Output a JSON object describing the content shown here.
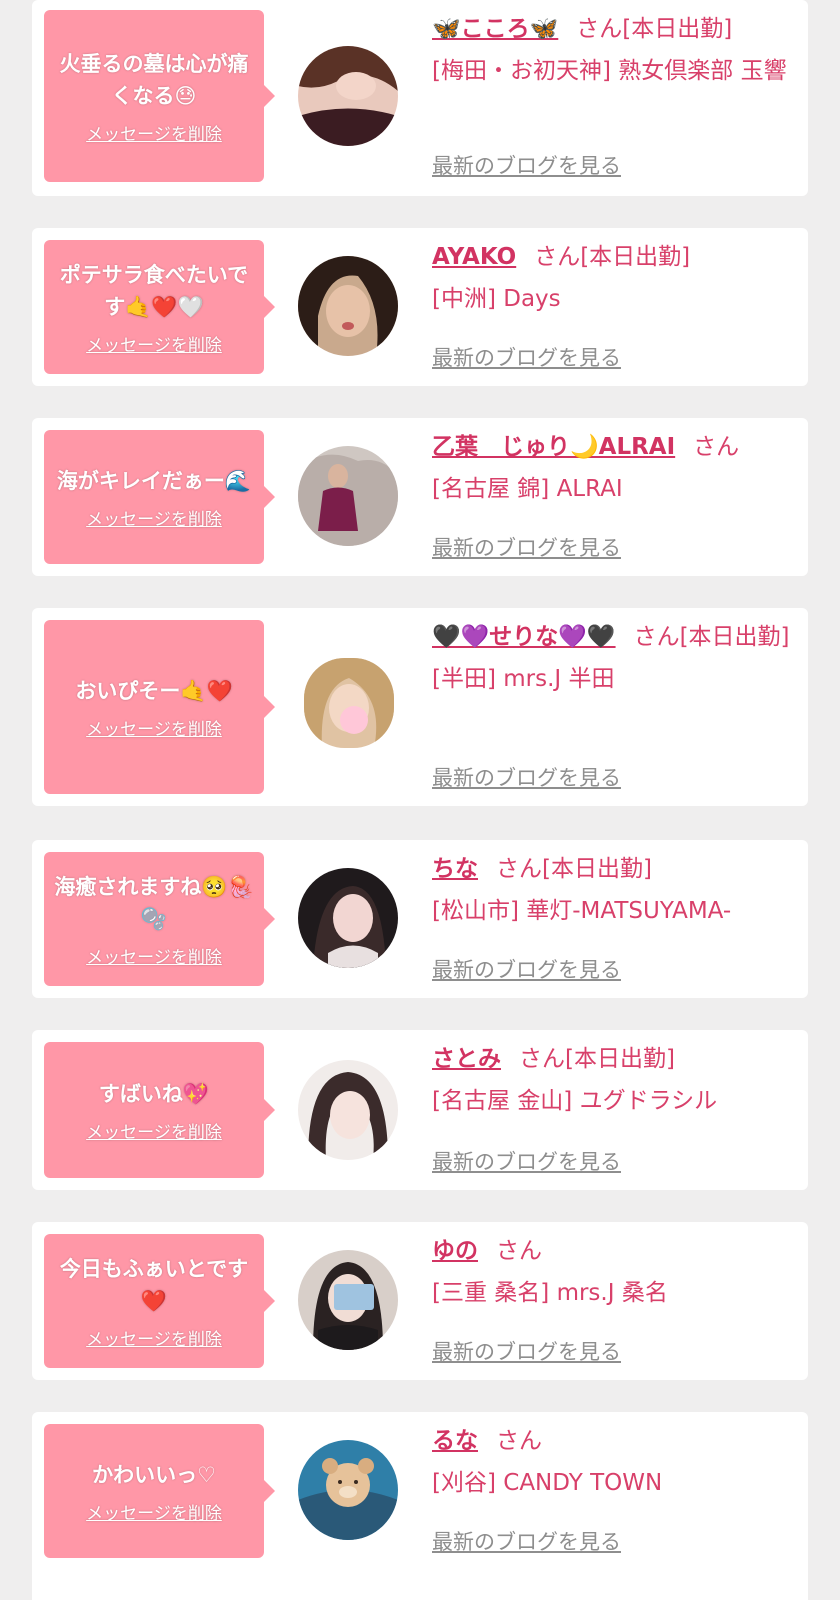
{
  "cards": [
    {
      "message": "火垂るの墓は心が痛くなる😓",
      "delete_label": "メッセージを削除",
      "name": "🦋こころ🦋",
      "san": "さん[本日出勤]",
      "shop": "[梅田・お初天神] 熟女倶楽部 玉響",
      "blog_label": "最新のブログを見る",
      "avatar": "avatar-woman-dark-top"
    },
    {
      "message": "ポテサラ食べたいです🤙❤️🤍",
      "delete_label": "メッセージを削除",
      "name": "AYAKO",
      "san": "さん[本日出勤]",
      "shop": "[中洲] Days",
      "blog_label": "最新のブログを見る",
      "avatar": "avatar-woman-selfie"
    },
    {
      "message": "海がキレイだぁー🌊",
      "delete_label": "メッセージを削除",
      "name": "乙葉　じゅり🌙ALRAI",
      "san": "さん",
      "shop": "[名古屋 錦] ALRAI",
      "blog_label": "最新のブログを見る",
      "avatar": "avatar-woman-on-chair"
    },
    {
      "message": "おいぴそー🤙❤️",
      "delete_label": "メッセージを削除",
      "name": "🖤💜せりな💜🖤",
      "san": "さん[本日出勤]",
      "shop": "[半田] mrs.J 半田",
      "blog_label": "最新のブログを見る",
      "avatar": "avatar-blonde-woman"
    },
    {
      "message": "海癒されますね🥺🪼🫧",
      "delete_label": "メッセージを削除",
      "name": "ちな",
      "san": "さん[本日出勤]",
      "shop": "[松山市] 華灯-MATSUYAMA-",
      "blog_label": "最新のブログを見る",
      "avatar": "avatar-woman-dark-room"
    },
    {
      "message": "すばいね💖",
      "delete_label": "メッセージを削除",
      "name": "さとみ",
      "san": "さん[本日出勤]",
      "shop": "[名古屋 金山] ユグドラシル",
      "blog_label": "最新のブログを見る",
      "avatar": "avatar-woman-long-hair"
    },
    {
      "message": "今日もふぁいとです❤️",
      "delete_label": "メッセージを削除",
      "name": "ゆの",
      "san": "さん",
      "shop": "[三重 桑名] mrs.J 桑名",
      "blog_label": "最新のブログを見る",
      "avatar": "avatar-woman-holding-card"
    },
    {
      "message": "かわいいっ♡",
      "delete_label": "メッセージを削除",
      "name": "るな",
      "san": "さん",
      "shop": "[刈谷] CANDY TOWN",
      "blog_label": "最新のブログを見る",
      "avatar": "avatar-bear-sticker"
    }
  ],
  "colors": {
    "background": "#efeeee",
    "card": "#ffffff",
    "bubble": "#ff97a7",
    "name": "#d23362",
    "text": "#d8406a",
    "link_gray": "#8e8e8e"
  }
}
